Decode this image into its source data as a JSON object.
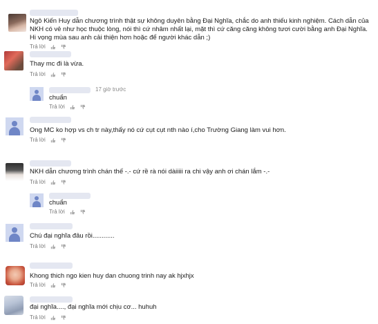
{
  "comments": [
    {
      "text": "Ngô Kiến Huy dẫn chương trình thật sự không duyên bằng Đại Nghĩa, chắc do anh thiếu kinh nghiệm. Cách dẫn của NKH có vẻ như học thuộc lòng, nói thì cứ nhâm nhất lại, mặt thì cứ căng căng không tươi cười bằng anh Đại Nghĩa. Hi vọng mùa sau anh cải thiện hơn hoặc để người khác dẫn ;)",
      "reply": "Trả lời"
    },
    {
      "text": "Thay mc đi là vừa.",
      "reply": "Trả lời"
    },
    {
      "text": "chuẩn",
      "reply": "Trả lời",
      "time": "17 giờ trước"
    },
    {
      "text": "Ong MC ko hợp vs ch tr này,thấy nó cứ cụt cụt nth nào í,cho Trường Giang làm vui hơn.",
      "reply": "Trả lời"
    },
    {
      "text": "NKH dẫn chương trình chán thế -.- cứ rề rà nói dàiiiii ra chi vậy anh ơi chán lắm -.-",
      "reply": "Trả lời"
    },
    {
      "text": "chuẩn",
      "reply": "Trả lời"
    },
    {
      "text": "Chú đại nghĩa đâu rồi............",
      "reply": "Trả lời"
    },
    {
      "text": "Khong thich ngo kien huy dan chuong trinh nay ak hjxhjx",
      "reply": "Trả lời"
    },
    {
      "text": "đại nghĩa...., đại nghĩa mới chịu cơ... huhuh",
      "reply": "Trả lời"
    }
  ],
  "icons": {
    "like": "thumbs-up-icon",
    "dislike": "thumbs-down-icon",
    "avatar": "default-user-icon"
  },
  "colors": {
    "avatar_bg": "#cfd8f0",
    "avatar_fg": "#6f86c6",
    "name_blur": "#e4e7f1",
    "meta_text": "#777777"
  }
}
